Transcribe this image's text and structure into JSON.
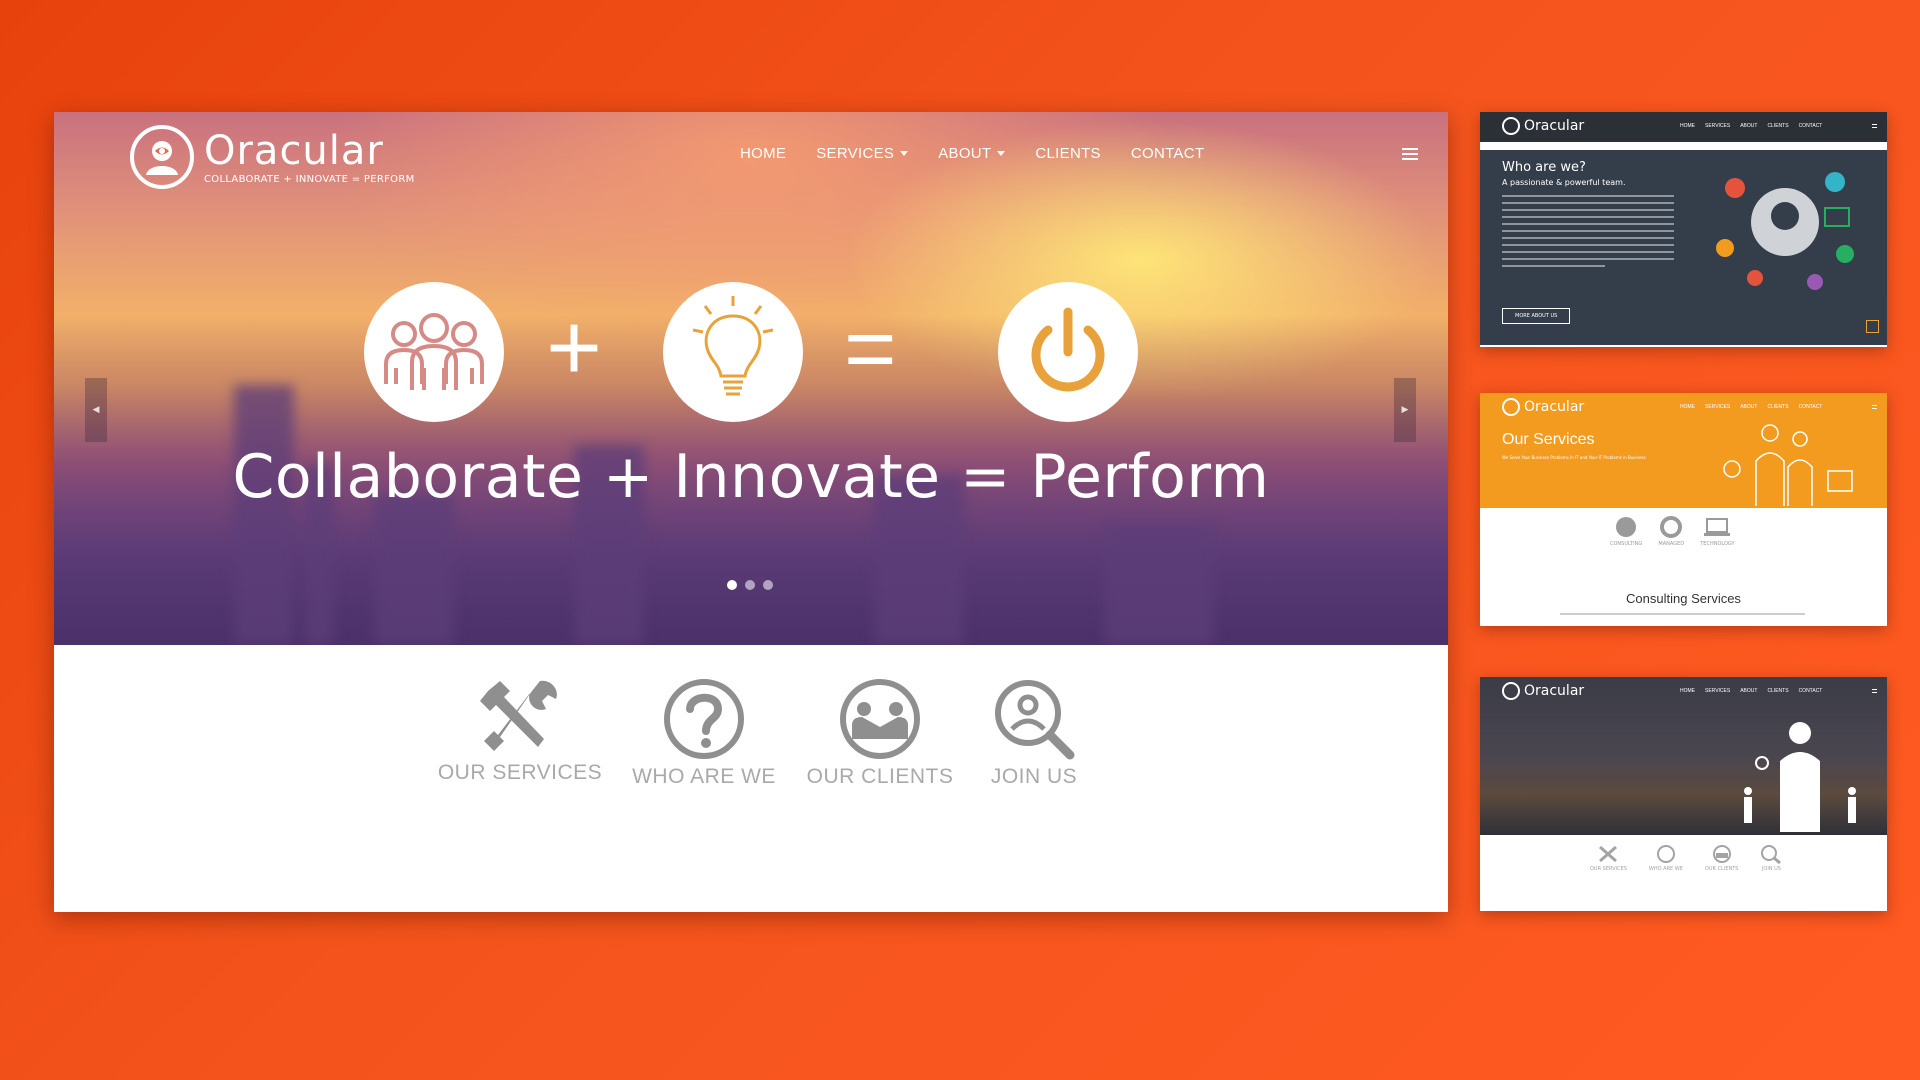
{
  "brand": {
    "name": "Oracular",
    "tagline": "COLLABORATE + INNOVATE = PERFORM"
  },
  "nav": {
    "items": [
      {
        "label": "HOME",
        "dropdown": false
      },
      {
        "label": "SERVICES",
        "dropdown": true
      },
      {
        "label": "ABOUT",
        "dropdown": true
      },
      {
        "label": "CLIENTS",
        "dropdown": false
      },
      {
        "label": "CONTACT",
        "dropdown": false
      }
    ],
    "menu_icon": "hamburger-icon"
  },
  "hero": {
    "icons": [
      "people-icon",
      "lightbulb-icon",
      "power-icon"
    ],
    "operators": [
      "+",
      "="
    ],
    "tagline": "Collaborate + Innovate = Perform",
    "slides": 3,
    "active_slide": 1,
    "prev_icon": "caret-left-icon",
    "next_icon": "caret-right-icon"
  },
  "quick_links": [
    {
      "label": "OUR SERVICES",
      "icon": "tools-icon"
    },
    {
      "label": "WHO ARE WE",
      "icon": "question-icon"
    },
    {
      "label": "OUR CLIENTS",
      "icon": "handshake-icon"
    },
    {
      "label": "JOIN US",
      "icon": "search-person-icon"
    }
  ],
  "thumbnails": {
    "about": {
      "nav": [
        "HOME",
        "SERVICES",
        "ABOUT",
        "CLIENTS",
        "CONTACT"
      ],
      "heading": "Who are we?",
      "subheading": "A passionate & powerful team.",
      "button": "MORE ABOUT US"
    },
    "services": {
      "nav": [
        "HOME",
        "SERVICES",
        "ABOUT",
        "CLIENTS",
        "CONTACT"
      ],
      "heading": "Our Services",
      "subheading": "We Solve Your Business Problems in IT and Your IT Problems in Business",
      "icons": [
        "CONSULTING",
        "MANAGED",
        "TECHNOLOGY"
      ],
      "section_title": "Consulting Services"
    },
    "home_alt": {
      "nav": [
        "HOME",
        "SERVICES",
        "ABOUT",
        "CLIENTS",
        "CONTACT"
      ],
      "quick_links": [
        "OUR SERVICES",
        "WHO ARE WE",
        "OUR CLIENTS",
        "JOIN US"
      ]
    }
  },
  "colors": {
    "background": "#f4541c",
    "services_orange": "#f39b1f",
    "about_navy": "#343e4b",
    "quick_link_gray": "#a9a9a9",
    "hero_icon_accent": "#e9a23b",
    "people_icon": "#d68a86"
  }
}
